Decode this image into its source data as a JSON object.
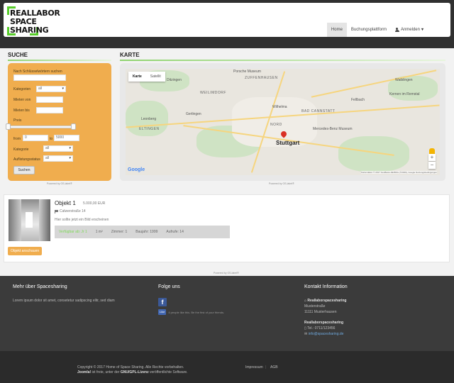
{
  "header": {
    "logo": [
      "REALLABOR",
      "SPACE",
      "SHARING"
    ],
    "nav": [
      {
        "label": "Home",
        "active": true
      },
      {
        "label": "Buchungsplattform",
        "active": false
      },
      {
        "label": "Anmelden"
      }
    ]
  },
  "search": {
    "title": "SUCHE",
    "keyword_label": "Nach Schlüsselwörtern suchen",
    "keyword_value": "",
    "category_label": "Kategorien",
    "category_value": "all",
    "rent_from_label": "Mieten von",
    "rent_to_label": "Mieten bis",
    "price_label": "Preis",
    "price_from_label": "from",
    "price_from_value": "0",
    "price_to_label": "to",
    "price_to_value": "5000",
    "kategorie_label": "Kategorie",
    "kategorie_value": "all",
    "listing_status_label": "Auflistungsstatus",
    "listing_status_value": "all",
    "submit_label": "Suchen",
    "powered": "Powered by OS-label®"
  },
  "map": {
    "title": "KARTE",
    "tabs": [
      "Karte",
      "Satellit"
    ],
    "labels": {
      "porsche": "Porsche Museum",
      "zuffenhausen": "ZUFFENHAUSEN",
      "weilimdorf": "WEILIMDORF",
      "ditzingen": "Ditzingen",
      "nord": "NORD",
      "stuttgart": "Stuttgart",
      "bad_cannstatt": "BAD CANNSTATT",
      "fellbach": "Fellbach",
      "waiblingen": "Waiblingen",
      "kernen": "Kernen im Remstal",
      "mercedes": "Mercedes-Benz Museum",
      "gerlingen": "Gerlingen",
      "leonberg": "Leonberg",
      "eltingen": "ELTINGEN",
      "wilhelma": "Wilhelma"
    },
    "google": "Google",
    "attribution": "Kartendaten © 2017 GeoBasis-DE/BKG (©2009), Google   Nutzungsbedingungen",
    "zoom_in": "+",
    "zoom_out": "−",
    "powered": "Powered by OS-label®"
  },
  "result": {
    "title": "Objekt 1",
    "price": "5.000,00 EUR",
    "address": "Calwerstraße 14",
    "description": "Hier sollte jetzt ein Bild erscheinen",
    "meta": {
      "status": "Verfügbar ab: Jr 1",
      "size": "1 m²",
      "rooms": "Zimmer: 1",
      "year": "Baujahr: 1999",
      "views": "Aufrufe: 14"
    },
    "view_button": "Objekt anschauen",
    "powered": "Powered by OS-label®"
  },
  "footer": {
    "about_title": "Mehr über Spacesharing",
    "about_text": "Lorem ipsum dolor sit amet, consetetur sadipscing elitr, sed diam",
    "follow_title": "Folge uns",
    "fb_like_label": "Like",
    "fb_like_text": "4 people like this. Be the first of your friends.",
    "contact_title": "Kontakt Information",
    "contact_name": "Reallaborspacesharing",
    "contact_street": "Musterstraße",
    "contact_city": "11111 Musterhausen",
    "contact_name2": "Reallaborspacesharing",
    "contact_phone": "Tel.: 0711/123456",
    "contact_email": "info@spacesharing.de"
  },
  "bottom": {
    "copyright": "Copyright © 2017 Home of Space Sharing. Alle Rechte vorbehalten.",
    "joomla_1": "Joomla!",
    "joomla_2": " ist freie, unter der ",
    "joomla_3": "GNU/GPL-Lizenz",
    "joomla_4": " veröffentlichte Software.",
    "links": [
      "Impressum",
      "AGB"
    ]
  },
  "colors": {
    "accent_orange": "#f0ad4e",
    "brand_green": "#57cc2a",
    "footer_dark": "#3b3b3b"
  }
}
